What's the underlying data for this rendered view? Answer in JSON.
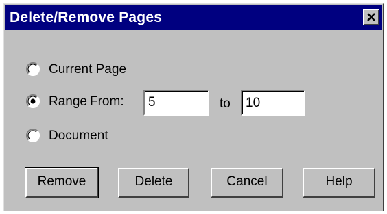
{
  "dialog": {
    "title": "Delete/Remove Pages",
    "close_icon": "close-icon"
  },
  "options": {
    "current_page": {
      "label": "Current Page",
      "selected": false
    },
    "range": {
      "label": "Range",
      "selected": true
    },
    "document": {
      "label": "Document",
      "selected": false
    }
  },
  "range_fields": {
    "from_label": "From:",
    "from_value": "5",
    "to_label": "to",
    "to_value": "10"
  },
  "buttons": {
    "remove": "Remove",
    "delete": "Delete",
    "cancel": "Cancel",
    "help": "Help"
  },
  "colors": {
    "titlebar": "#000080",
    "dialog_face": "#c0c0c0"
  }
}
